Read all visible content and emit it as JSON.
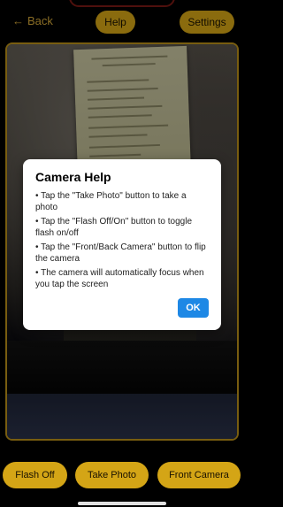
{
  "header": {
    "back_label": "Back",
    "help_label": "Help",
    "settings_label": "Settings"
  },
  "dialog": {
    "title": "Camera Help",
    "items": [
      "• Tap the \"Take Photo\" button to take a photo",
      "• Tap the \"Flash Off/On\" button to toggle flash on/off",
      "• Tap the \"Front/Back Camera\" button to flip the camera",
      "• The camera will automatically focus when you tap the screen"
    ],
    "ok_label": "OK"
  },
  "controls": {
    "flash_label": "Flash Off",
    "photo_label": "Take Photo",
    "camera_label": "Front Camera"
  },
  "colors": {
    "accent": "#d4a516",
    "dialog_button": "#1e88e5",
    "back_text": "#d4a83a"
  },
  "icons": {
    "back": "chevron-left-arrow-icon"
  }
}
